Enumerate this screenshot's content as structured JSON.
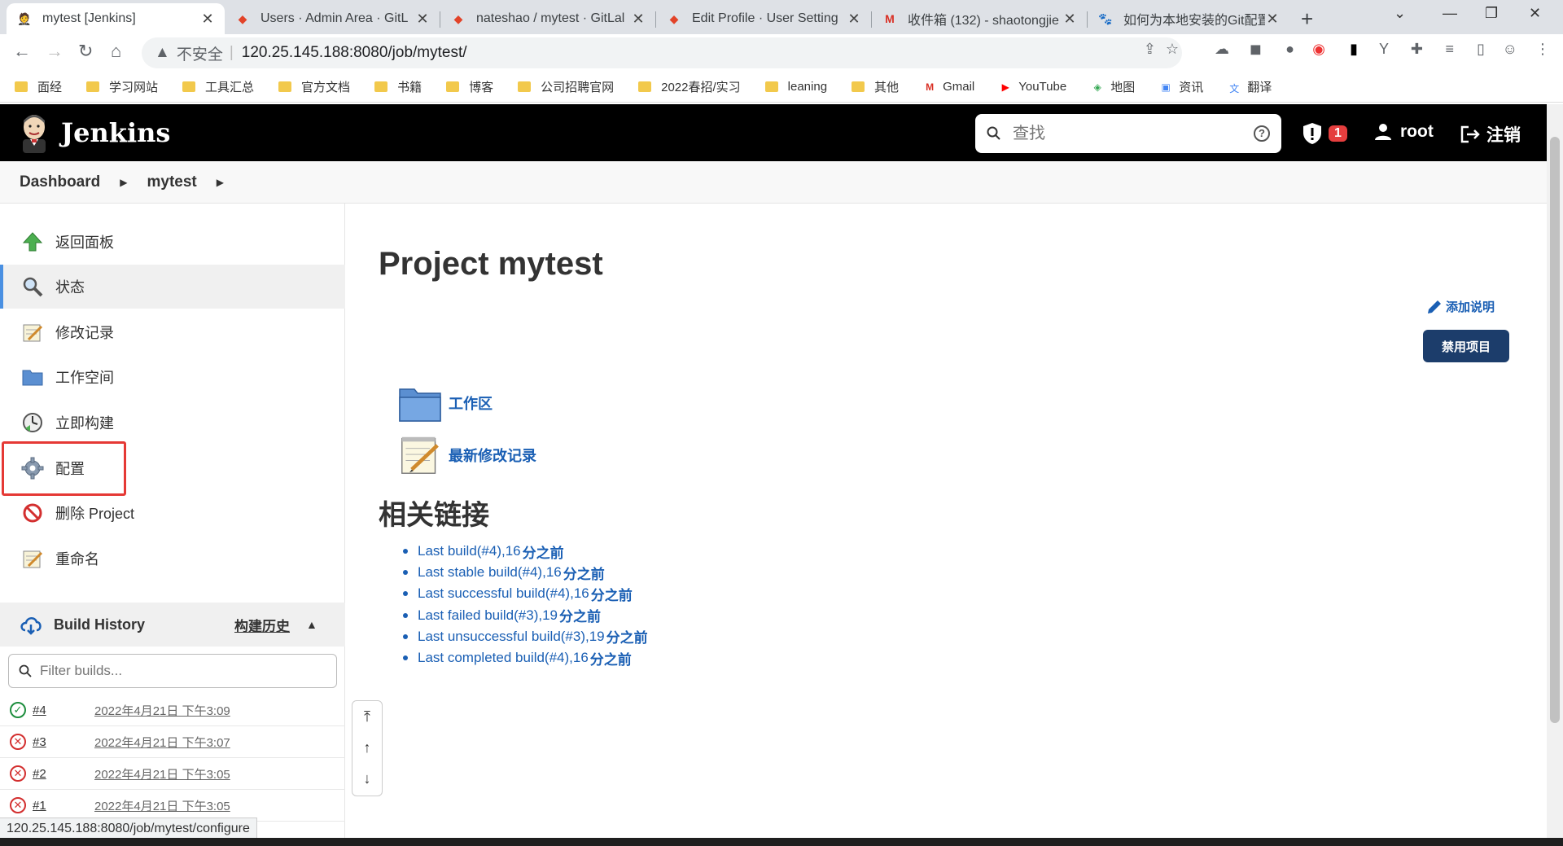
{
  "browser": {
    "tabs": [
      {
        "title": "mytest [Jenkins]",
        "icon": "jenkins-icon",
        "active": true
      },
      {
        "title": "Users · Admin Area · GitL",
        "icon": "gitlab-icon"
      },
      {
        "title": "nateshao / mytest · GitLal",
        "icon": "gitlab-icon"
      },
      {
        "title": "Edit Profile · User Setting",
        "icon": "gitlab-icon"
      },
      {
        "title": "收件箱 (132) - shaotongjie",
        "icon": "gmail-icon"
      },
      {
        "title": "如何为本地安装的Git配置全",
        "icon": "baidu-icon"
      }
    ],
    "address": {
      "security_label": "不安全",
      "url": "120.25.145.188:8080/job/mytest/"
    },
    "bookmarks": [
      {
        "label": "面经",
        "icon": "folder"
      },
      {
        "label": "学习网站",
        "icon": "folder"
      },
      {
        "label": "工具汇总",
        "icon": "folder"
      },
      {
        "label": "官方文档",
        "icon": "folder"
      },
      {
        "label": "书籍",
        "icon": "folder"
      },
      {
        "label": "博客",
        "icon": "folder"
      },
      {
        "label": "公司招聘官网",
        "icon": "folder"
      },
      {
        "label": "2022春招/实习",
        "icon": "folder"
      },
      {
        "label": "leaning",
        "icon": "folder"
      },
      {
        "label": "其他",
        "icon": "folder"
      },
      {
        "label": "Gmail",
        "icon": "gmail"
      },
      {
        "label": "YouTube",
        "icon": "youtube"
      },
      {
        "label": "地图",
        "icon": "maps"
      },
      {
        "label": "资讯",
        "icon": "news"
      },
      {
        "label": "翻译",
        "icon": "translate"
      }
    ],
    "status_url": "120.25.145.188:8080/job/mytest/configure"
  },
  "header": {
    "brand": "Jenkins",
    "search_placeholder": "查找",
    "security_count": "1",
    "user": "root",
    "logout": "注销"
  },
  "breadcrumb": [
    "Dashboard",
    "mytest"
  ],
  "sidebar": {
    "items": [
      {
        "label": "返回面板",
        "icon": "up-arrow-icon"
      },
      {
        "label": "状态",
        "icon": "search-icon"
      },
      {
        "label": "修改记录",
        "icon": "notepad-icon"
      },
      {
        "label": "工作空间",
        "icon": "folder-icon"
      },
      {
        "label": "立即构建",
        "icon": "clock-icon"
      },
      {
        "label": "配置",
        "icon": "gear-icon"
      },
      {
        "label": "删除 Project",
        "icon": "no-entry-icon"
      },
      {
        "label": "重命名",
        "icon": "notepad-icon"
      }
    ]
  },
  "build_history": {
    "title": "Build History",
    "title_cn": "构建历史",
    "filter_placeholder": "Filter builds...",
    "builds": [
      {
        "number": "#4",
        "time": "2022年4月21日 下午3:09",
        "status": "success"
      },
      {
        "number": "#3",
        "time": "2022年4月21日 下午3:07",
        "status": "failed"
      },
      {
        "number": "#2",
        "time": "2022年4月21日 下午3:05",
        "status": "failed"
      },
      {
        "number": "#1",
        "time": "2022年4月21日 下午3:05",
        "status": "failed"
      }
    ]
  },
  "main": {
    "title": "Project mytest",
    "add_description": "添加说明",
    "disable_button": "禁用项目",
    "links": [
      {
        "label": "工作区",
        "icon": "folder-icon"
      },
      {
        "label": "最新修改记录",
        "icon": "notepad-icon"
      }
    ],
    "related_title": "相关链接",
    "related_links": [
      {
        "text": "Last build(#4),16",
        "suffix": "分之前"
      },
      {
        "text": "Last stable build(#4),16",
        "suffix": "分之前"
      },
      {
        "text": "Last successful build(#4),16",
        "suffix": "分之前"
      },
      {
        "text": "Last failed build(#3),19",
        "suffix": "分之前"
      },
      {
        "text": "Last unsuccessful build(#3),19",
        "suffix": "分之前"
      },
      {
        "text": "Last completed build(#4),16",
        "suffix": "分之前"
      }
    ]
  }
}
